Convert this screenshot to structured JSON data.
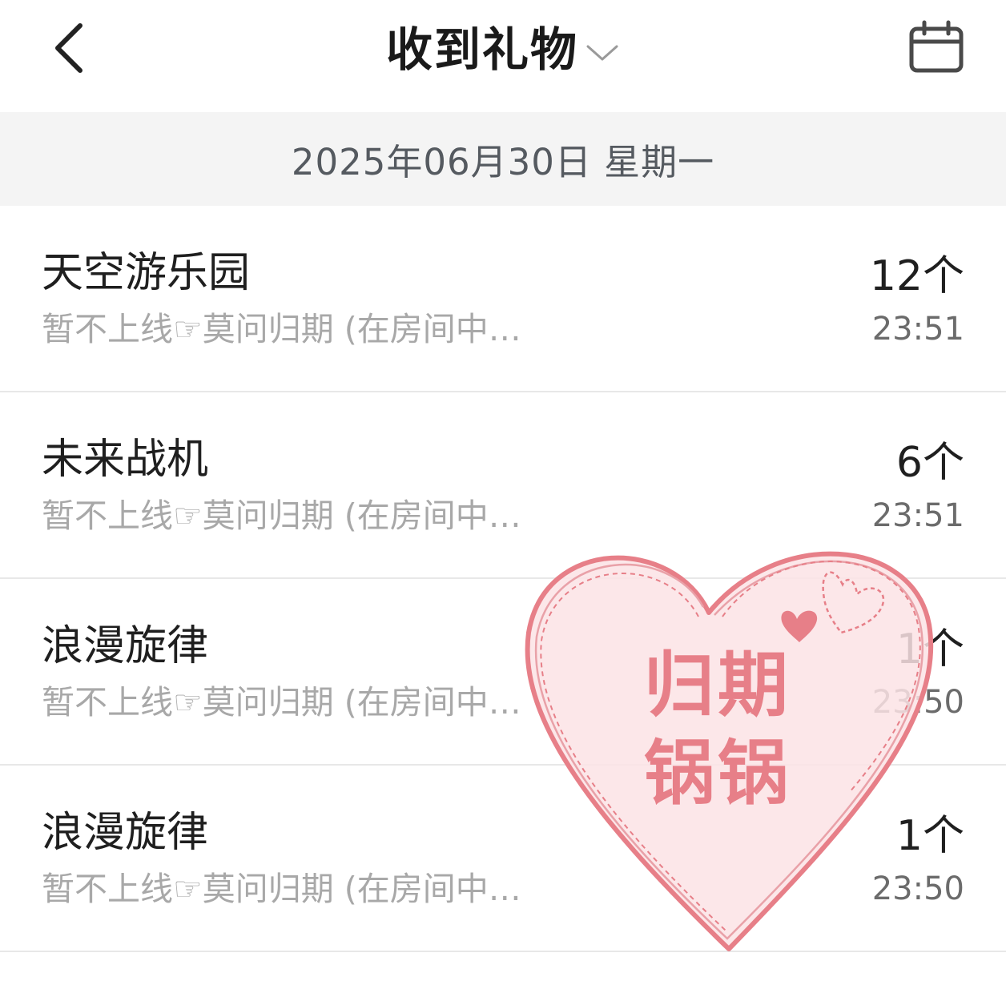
{
  "header": {
    "back_icon": "chevron-left-icon",
    "title": "收到礼物",
    "title_dropdown_icon": "chevron-down-icon",
    "calendar_icon": "calendar-icon"
  },
  "date_bar": {
    "date": "2025年06月30日 星期一"
  },
  "gifts": [
    {
      "name": "天空游乐园",
      "from": "暂不上线☞莫问归期 (在房间中…",
      "count": "12个",
      "time": "23:51"
    },
    {
      "name": "未来战机",
      "from": "暂不上线☞莫问归期 (在房间中…",
      "count": "6个",
      "time": "23:51"
    },
    {
      "name": "浪漫旋律",
      "from": "暂不上线☞莫问归期 (在房间中…",
      "count": "1个",
      "time": "23:50"
    },
    {
      "name": "浪漫旋律",
      "from": "暂不上线☞莫问归期 (在房间中…",
      "count": "1个",
      "time": "23:50"
    }
  ],
  "watermark": {
    "line1": "归期",
    "line2": "锅锅",
    "icon": "heart-icon",
    "color": "#e77f88",
    "fill": "#fbe3e5"
  },
  "colors": {
    "date_bar_bg": "#f4f4f4",
    "divider": "#e8e8e8",
    "title": "#1a1a1a",
    "subtext": "#a8a8a8"
  }
}
